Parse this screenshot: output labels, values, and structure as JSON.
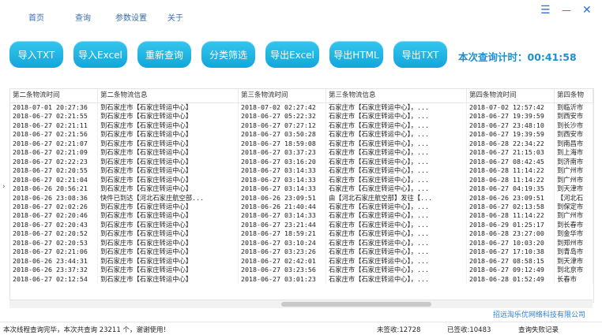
{
  "menu": {
    "items": [
      "首页",
      "查询",
      "参数设置",
      "关于"
    ]
  },
  "window_controls": {
    "menu": "☰",
    "minimize": "—",
    "close": "✕"
  },
  "toolbar": {
    "buttons": [
      "导入TXT",
      "导入Excel",
      "重新查询",
      "分类筛选",
      "导出Excel",
      "导出HTML",
      "导出TXT"
    ]
  },
  "timer": {
    "label": "本次查询计时：",
    "value": "00:41:58"
  },
  "table": {
    "columns": [
      "第二条物流时间",
      "第二条物流信息",
      "第三条物流时间",
      "第三条物流信息",
      "第四条物流时间",
      "第四条物"
    ],
    "rows": [
      [
        "2018-07-01 20:27:36",
        "到石家庄市【石家庄转运中心】",
        "2018-07-02 02:27:42",
        "石家庄市【石家庄转运中心】，...",
        "2018-07-02 12:57:42",
        "到临沂市"
      ],
      [
        "2018-06-27 02:21:55",
        "到石家庄市【石家庄转运中心】",
        "2018-06-27 05:22:32",
        "石家庄市【石家庄转运中心】，...",
        "2018-06-27 19:39:59",
        "到西安市"
      ],
      [
        "2018-06-27 02:21:11",
        "到石家庄市【石家庄转运中心】",
        "2018-06-27 07:27:12",
        "石家庄市【石家庄转运中心】，...",
        "2018-06-27 23:48:10",
        "到长沙市"
      ],
      [
        "2018-06-27 02:21:56",
        "到石家庄市【石家庄转运中心】",
        "2018-06-27 03:50:28",
        "石家庄市【石家庄转运中心】，...",
        "2018-06-27 19:39:59",
        "到西安市"
      ],
      [
        "2018-06-27 02:21:07",
        "到石家庄市【石家庄转运中心】",
        "2018-06-27 18:59:08",
        "石家庄市【石家庄转运中心】，...",
        "2018-06-28 22:34:22",
        "到南昌市"
      ],
      [
        "2018-06-27 02:21:09",
        "到石家庄市【石家庄转运中心】",
        "2018-06-27 03:37:23",
        "石家庄市【石家庄转运中心】，...",
        "2018-06-27 21:15:03",
        "到上海市"
      ],
      [
        "2018-06-27 02:22:23",
        "到石家庄市【石家庄转运中心】",
        "2018-06-27 03:16:20",
        "石家庄市【石家庄转运中心】，...",
        "2018-06-27 08:42:45",
        "到济南市"
      ],
      [
        "2018-06-27 02:20:55",
        "到石家庄市【石家庄转运中心】",
        "2018-06-27 03:14:33",
        "石家庄市【石家庄转运中心】，...",
        "2018-06-28 11:14:22",
        "到广州市"
      ],
      [
        "2018-06-27 02:21:04",
        "到石家庄市【石家庄转运中心】",
        "2018-06-27 03:14:33",
        "石家庄市【石家庄转运中心】，...",
        "2018-06-28 11:14:22",
        "到广州市"
      ],
      [
        "2018-06-26 20:56:21",
        "到石家庄市【石家庄转运中心】",
        "2018-06-27 03:14:33",
        "石家庄市【石家庄转运中心】，...",
        "2018-06-27 04:19:35",
        "到天津市"
      ],
      [
        "2018-06-26 23:08:36",
        "快件已到达【河北石家庄航空部...",
        "2018-06-26 23:09:51",
        "由【河北石家庄航空部】发往【...",
        "2018-06-26 23:09:51",
        "【河北石"
      ],
      [
        "2018-06-27 02:02:26",
        "到石家庄市【石家庄转运中心】",
        "2018-06-26 21:40:44",
        "石家庄市【石家庄转运中心】，...",
        "2018-06-27 02:13:58",
        "到保定市"
      ],
      [
        "2018-06-27 02:20:46",
        "到石家庄市【石家庄转运中心】",
        "2018-06-27 03:14:33",
        "石家庄市【石家庄转运中心】，...",
        "2018-06-28 11:14:22",
        "到广州市"
      ],
      [
        "2018-06-27 02:20:43",
        "到石家庄市【石家庄转运中心】",
        "2018-06-27 23:21:44",
        "石家庄市【石家庄转运中心】，...",
        "2018-06-29 01:25:17",
        "到长春市"
      ],
      [
        "2018-06-27 02:20:52",
        "到石家庄市【石家庄转运中心】",
        "2018-06-27 18:59:21",
        "石家庄市【石家庄转运中心】，...",
        "2018-06-28 23:27:00",
        "到金华市"
      ],
      [
        "2018-06-27 02:20:53",
        "到石家庄市【石家庄转运中心】",
        "2018-06-27 03:10:24",
        "石家庄市【石家庄转运中心】，...",
        "2018-06-27 10:03:20",
        "到郑州市"
      ],
      [
        "2018-06-27 02:21:06",
        "到石家庄市【石家庄转运中心】",
        "2018-06-27 03:23:26",
        "石家庄市【石家庄转运中心】，...",
        "2018-06-27 17:10:38",
        "到青岛市"
      ],
      [
        "2018-06-26 23:44:31",
        "到石家庄市【石家庄转运中心】",
        "2018-06-27 02:42:01",
        "石家庄市【石家庄转运中心】，...",
        "2018-06-27 08:58:15",
        "到天津市"
      ],
      [
        "2018-06-26 23:37:32",
        "到石家庄市【石家庄转运中心】",
        "2018-06-27 03:23:56",
        "石家庄市【石家庄转运中心】，...",
        "2018-06-27 09:12:49",
        "到北京市"
      ],
      [
        "2018-06-27 02:12:54",
        "到石家庄市【石家庄转运中心】",
        "2018-06-27 03:01:23",
        "石家庄市【石家庄转运中心】，...",
        "2018-06-28 01:52:49",
        "长春市"
      ]
    ]
  },
  "company": "招远淘乐优网络科技有限公司",
  "status": {
    "message": "本次线程查询完毕，本次共查询 23211 个，谢谢使用！",
    "unsigned": "未签收:12728",
    "signed": "已签收:10483",
    "fail_log": "查询失败记录"
  }
}
